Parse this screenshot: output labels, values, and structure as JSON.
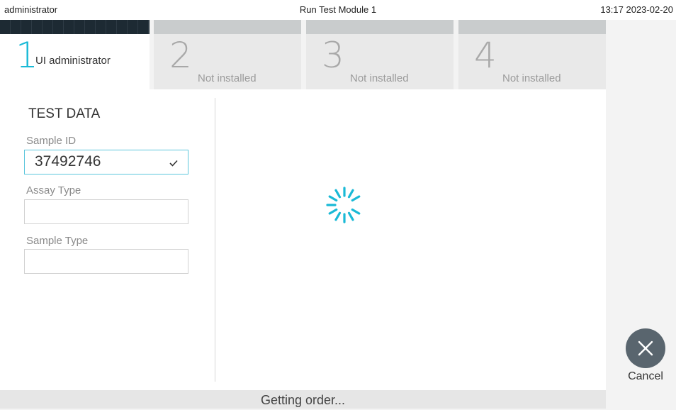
{
  "topbar": {
    "user": "administrator",
    "title": "Run Test Module 1",
    "datetime": "13:17 2023-02-20"
  },
  "tabs": [
    {
      "number": "1",
      "label": "UI administrator",
      "active": true
    },
    {
      "number": "2",
      "label": "Not installed",
      "active": false
    },
    {
      "number": "3",
      "label": "Not installed",
      "active": false
    },
    {
      "number": "4",
      "label": "Not installed",
      "active": false
    }
  ],
  "test_data": {
    "title": "TEST DATA",
    "sample_id": {
      "label": "Sample ID",
      "value": "37492746"
    },
    "assay_type": {
      "label": "Assay Type",
      "value": ""
    },
    "sample_type": {
      "label": "Sample Type",
      "value": ""
    }
  },
  "cancel": {
    "label": "Cancel",
    "icon": "close-icon"
  },
  "status": {
    "text": "Getting order..."
  },
  "colors": {
    "accent": "#19b9d6",
    "cancel_button": "#59656e"
  }
}
